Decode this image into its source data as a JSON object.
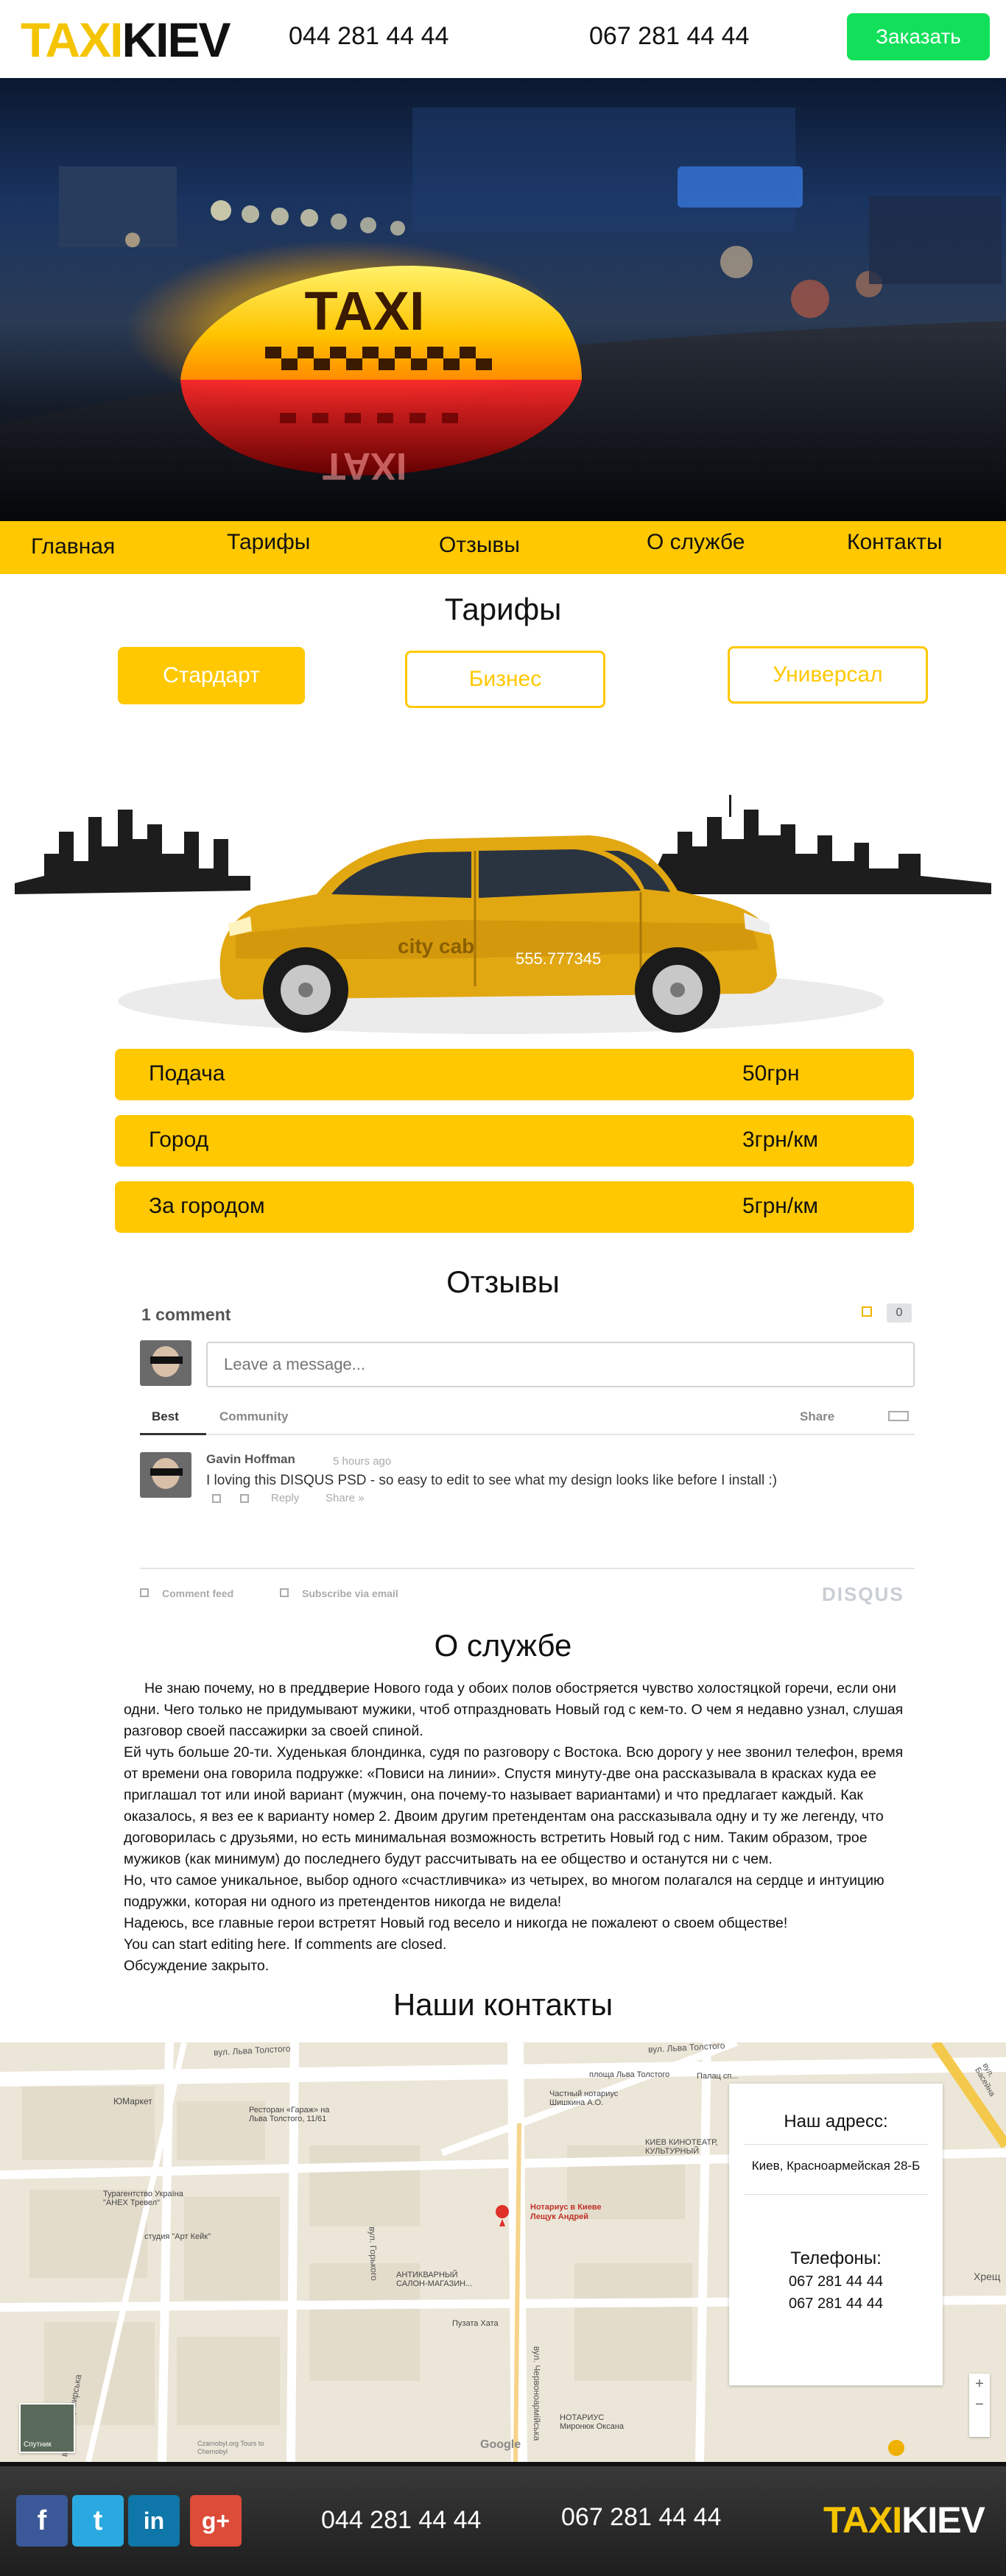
{
  "header": {
    "logo_part1": "TAXI",
    "logo_part2": "KIEV",
    "phone1": "044 281 44 44",
    "phone2": "067 281 44 44",
    "order_button": "Заказать"
  },
  "hero": {
    "sign_text": "TAXI",
    "sign_reflection": "TAXI"
  },
  "nav": {
    "items": [
      "Главная",
      "Тарифы",
      "Отзывы",
      "О службе",
      "Контакты"
    ]
  },
  "tariffs": {
    "title": "Тарифы",
    "tabs": [
      "Стардарт",
      "Бизнес",
      "Универсал"
    ],
    "active_tab": "Стардарт",
    "car_brand": "city cab",
    "car_phone": "555.777345",
    "rates": [
      {
        "name": "Подача",
        "value": "50грн"
      },
      {
        "name": "Город",
        "value": "3грн/км"
      },
      {
        "name": "За городом",
        "value": "5грн/км"
      }
    ]
  },
  "reviews": {
    "title": "Отзывы",
    "comment_count": "1 comment",
    "like_count": "0",
    "input_placeholder": "Leave a message...",
    "tab_best": "Best",
    "tab_community": "Community",
    "share": "Share",
    "comment": {
      "author": "Gavin Hoffman",
      "time": "5 hours ago",
      "text": "I loving this DISQUS PSD - so easy to edit to see what my design looks like before I install :)",
      "reply": "Reply",
      "share": "Share »"
    },
    "footer_feed": "Comment feed",
    "footer_subscribe": "Subscribe via email",
    "brand": "DISQUS"
  },
  "about": {
    "title": "О службе",
    "paragraphs": [
      "Не знаю почему, но в преддверие Нового года у обоих полов обостряется чувство холостяцкой горечи, если они одни. Чего только не придумывают мужики, чтоб отпраздновать Новый год с кем-то. О чем я недавно узнал, слушая разговор своей пассажирки за своей спиной.",
      "Ей чуть больше 20-ти. Худенькая блондинка, судя по разговору с Востока. Всю дорогу у нее звонил телефон, время от времени она говорила подружке: «Повиси на линии». Спустя минуту-две она рассказывала в красках куда ее приглашал тот или иной вариант (мужчин, она почему-то называет вариантами) и что предлагает каждый. Как оказалось, я вез ее к варианту номер 2. Двоим другим претендентам она рассказывала одну и ту же легенду, что договорилась с друзьями, но есть минимальная возможность встретить Новый год с ним. Таким образом, трое мужиков (как минимум) до последнего будут рассчитывать на ее общество и останутся ни с чем.",
      "Но, что самое уникальное, выбор одного «счастливчика» из четырех, во многом полагался на сердце и интуицию подружки, которая ни одного из претендентов никогда не видела!",
      "Надеюсь, все главные герои встретят Новый год весело и никогда не пожалеют о своем обществе!",
      "You can start editing here. If comments are closed.",
      "Обсуждение закрыто."
    ]
  },
  "contacts": {
    "title": "Наши контакты",
    "address_title": "Наш адресс:",
    "address": "Киев, Красноармейская 28-Б",
    "phones_title": "Телефоны:",
    "phones": [
      "067 281 44 44",
      "067 281 44 44"
    ],
    "map_labels": {
      "street1": "вул. Льва Толстого",
      "street2": "вул. Льва Толстого",
      "street3": "вул. Червоноармійська",
      "street4": "вул. Горького",
      "street5": "вул. Володимирська",
      "marker_title": "Нотариус в Киеве Лещук Андрей",
      "shop1": "ЮМаркет",
      "shop2": "Ресторан «Гараж» на Льва Толстого, 11/61",
      "shop3": "Частный нотариус Шишкина А.О.",
      "shop4": "КИЕВ КИНОТЕАТР, КУЛЬТУРНЫЙ",
      "shop5": "Турагентство Україна \"АНЕХ Тревел\"",
      "shop6": "студия \"Арт Кейк\"",
      "shop7": "АНТИКВАРНЫЙ САЛОН-МАГАЗИН...",
      "shop8": "Пузата Хата",
      "shop9": "НОТАРИУС Миронюк Оксана",
      "metro": "площа Льва Толстого",
      "park": "Палац сп...",
      "district": "Хрещ",
      "street_bass": "вул. Басейна",
      "google": "Google",
      "satellite": "Спутник",
      "copyright": "Czarnobyl.org Tours to Chernobyl"
    }
  },
  "footer": {
    "social": [
      {
        "name": "facebook",
        "glyph": "f",
        "color": "#3b5998"
      },
      {
        "name": "twitter",
        "glyph": "t",
        "color": "#2aa9e0"
      },
      {
        "name": "linkedin",
        "glyph": "in",
        "color": "#0e76a8"
      },
      {
        "name": "google-plus",
        "glyph": "g+",
        "color": "#dd4b39"
      }
    ],
    "phone1": "044 281 44 44",
    "phone2": "067 281 44 44",
    "logo_part1": "TAXI",
    "logo_part2": "KIEV"
  },
  "colors": {
    "accent": "#ffc800",
    "order_button": "#12e05a",
    "footer_bg": "#2b2b2b"
  }
}
